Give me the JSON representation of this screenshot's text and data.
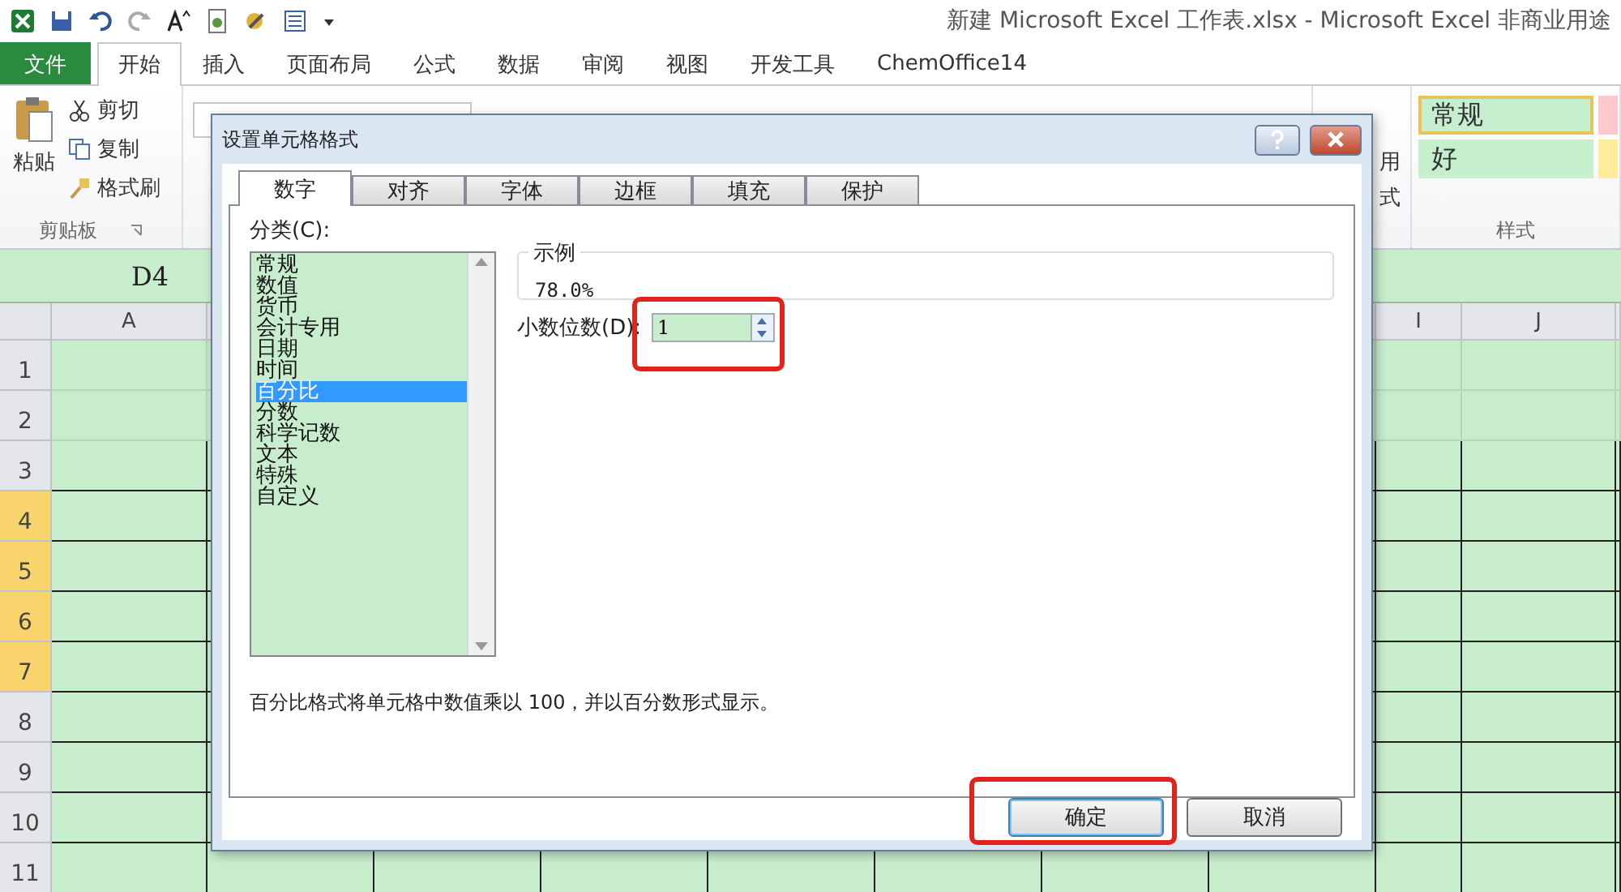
{
  "window": {
    "title": "新建 Microsoft Excel 工作表.xlsx - Microsoft Excel 非商业用途"
  },
  "ribbon": {
    "tabs": [
      {
        "label": "文件",
        "kind": "file",
        "selected": false
      },
      {
        "label": "开始",
        "kind": "tab",
        "selected": true
      },
      {
        "label": "插入",
        "kind": "tab",
        "selected": false
      },
      {
        "label": "页面布局",
        "kind": "tab",
        "selected": false
      },
      {
        "label": "公式",
        "kind": "tab",
        "selected": false
      },
      {
        "label": "数据",
        "kind": "tab",
        "selected": false
      },
      {
        "label": "审阅",
        "kind": "tab",
        "selected": false
      },
      {
        "label": "视图",
        "kind": "tab",
        "selected": false
      },
      {
        "label": "开发工具",
        "kind": "tab",
        "selected": false
      },
      {
        "label": "ChemOffice14",
        "kind": "tab",
        "selected": false
      }
    ],
    "clipboard": {
      "paste": "粘贴",
      "cut": "剪切",
      "copy": "复制",
      "format_painter": "格式刷",
      "group_label": "剪贴板"
    },
    "styles": {
      "fragment_1": "用",
      "fragment_2": "式",
      "group_label": "样式",
      "cells": [
        {
          "label": "常规",
          "color": "#c6efce",
          "selected": true
        },
        {
          "label": "好",
          "color": "#c6efce",
          "selected": false
        }
      ],
      "cut_cells": [
        {
          "color": "#ffc7ce"
        },
        {
          "color": "#ffeb9c"
        }
      ]
    }
  },
  "name_box": "D4",
  "sheet": {
    "columns": [
      {
        "label": "A"
      },
      {
        "label": "I"
      },
      {
        "label": "J"
      }
    ],
    "rows": [
      {
        "label": "1",
        "selected": false,
        "bordered": false
      },
      {
        "label": "2",
        "selected": false,
        "bordered": false
      },
      {
        "label": "3",
        "selected": false,
        "bordered": true
      },
      {
        "label": "4",
        "selected": true,
        "bordered": true
      },
      {
        "label": "5",
        "selected": true,
        "bordered": true
      },
      {
        "label": "6",
        "selected": true,
        "bordered": true
      },
      {
        "label": "7",
        "selected": true,
        "bordered": true
      },
      {
        "label": "8",
        "selected": false,
        "bordered": true
      },
      {
        "label": "9",
        "selected": false,
        "bordered": true
      },
      {
        "label": "10",
        "selected": false,
        "bordered": true
      },
      {
        "label": "11",
        "selected": false,
        "bordered": true
      }
    ]
  },
  "dialog": {
    "title": "设置单元格格式",
    "tabs": [
      {
        "label": "数字",
        "selected": true
      },
      {
        "label": "对齐",
        "selected": false
      },
      {
        "label": "字体",
        "selected": false
      },
      {
        "label": "边框",
        "selected": false
      },
      {
        "label": "填充",
        "selected": false
      },
      {
        "label": "保护",
        "selected": false
      }
    ],
    "category_label": "分类(C):",
    "categories": [
      {
        "label": "常规",
        "selected": false
      },
      {
        "label": "数值",
        "selected": false
      },
      {
        "label": "货币",
        "selected": false
      },
      {
        "label": "会计专用",
        "selected": false
      },
      {
        "label": "日期",
        "selected": false
      },
      {
        "label": "时间",
        "selected": false
      },
      {
        "label": "百分比",
        "selected": true
      },
      {
        "label": "分数",
        "selected": false
      },
      {
        "label": "科学记数",
        "selected": false
      },
      {
        "label": "文本",
        "selected": false
      },
      {
        "label": "特殊",
        "selected": false
      },
      {
        "label": "自定义",
        "selected": false
      }
    ],
    "sample_label": "示例",
    "sample_value": "78.0%",
    "decimal_label": "小数位数(D):",
    "decimal_value": "1",
    "decimal_highlighted": true,
    "description": "百分比格式将单元格中数值乘以 100，并以百分数形式显示。",
    "buttons": [
      {
        "label": "确定",
        "kind": "ok",
        "highlighted": true
      },
      {
        "label": "取消",
        "kind": "cancel",
        "highlighted": false
      }
    ]
  }
}
